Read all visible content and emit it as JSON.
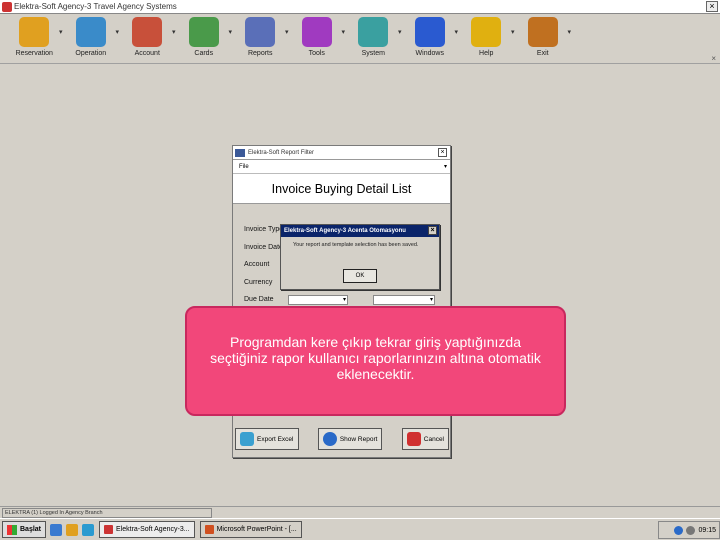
{
  "window": {
    "title": "Elektra-Soft Agency-3 Travel Agency Systems"
  },
  "toolbar": {
    "items": [
      {
        "label": "Reservation",
        "icon": "people-icon",
        "color": "#e0a020"
      },
      {
        "label": "Operation",
        "icon": "globe-icon",
        "color": "#3a8bc9"
      },
      {
        "label": "Account",
        "icon": "ledger-icon",
        "color": "#c8503a"
      },
      {
        "label": "Cards",
        "icon": "cards-icon",
        "color": "#4a9a4a"
      },
      {
        "label": "Reports",
        "icon": "report-icon",
        "color": "#5a6fb8"
      },
      {
        "label": "Tools",
        "icon": "tools-icon",
        "color": "#a03ac0"
      },
      {
        "label": "System",
        "icon": "gears-icon",
        "color": "#3aa0a0"
      },
      {
        "label": "Windows",
        "icon": "monitor-icon",
        "color": "#2a5ad0"
      },
      {
        "label": "Help",
        "icon": "help-icon",
        "color": "#e0b010"
      },
      {
        "label": "Exit",
        "icon": "exit-door-icon",
        "color": "#c07020"
      }
    ]
  },
  "dialog": {
    "title": "Elektra-Soft Report Filter",
    "menu_file": "File",
    "header": "Invoice Buying Detail List",
    "labels": [
      "Invoice Type",
      "Invoice Date",
      "Account",
      "Currency",
      "Due Date"
    ],
    "buttons": {
      "export": "Export Excel",
      "show": "Show Report",
      "cancel": "Cancel"
    }
  },
  "msgbox": {
    "title": "Elektra-Soft Agency-3 Acenta Otomasyonu",
    "text": "Your report and template selection has been saved.",
    "ok": "OK"
  },
  "callout": {
    "text": "Programdan kere çıkıp tekrar giriş yaptığınızda seçtiğiniz rapor kullanıcı raporlarınızın altına otomatik eklenecektir."
  },
  "statusbar": {
    "text": "ELEKTRA (1) Logged In Agency Branch"
  },
  "taskbar": {
    "start": "Başlat",
    "tasks": [
      "Elektra-Soft Agency-3...",
      "Microsoft PowerPoint - [..."
    ],
    "clock": "09:15"
  }
}
